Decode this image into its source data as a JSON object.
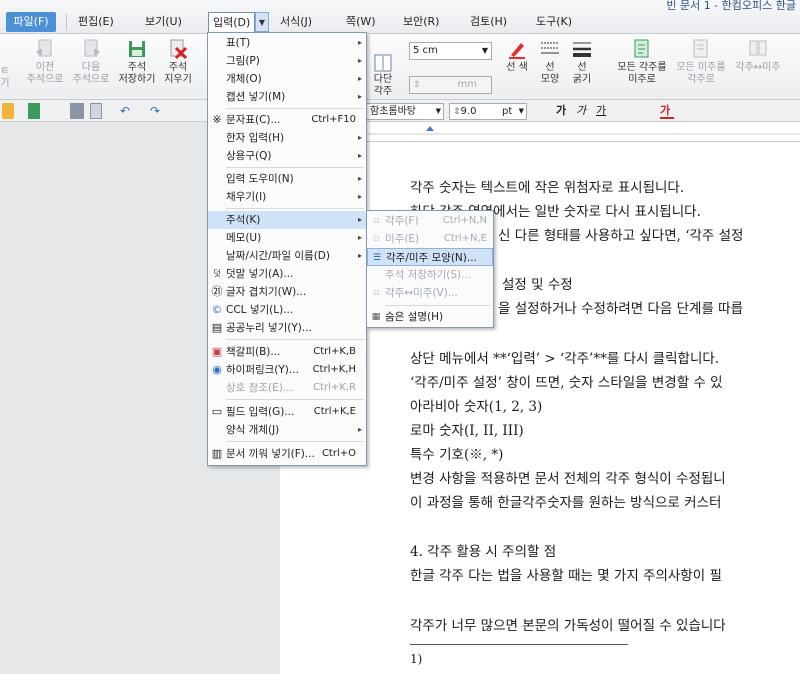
{
  "title": "빈 문서 1 - 한컴오피스 한글",
  "menubar": [
    "파일(F)",
    "편집(E)",
    "보기(U)",
    "입력(D)",
    "서식(J)",
    "쪽(W)",
    "보안(R)",
    "검토(H)",
    "도구(K)"
  ],
  "ribbon": {
    "prev_note": [
      "이전",
      "주석으로"
    ],
    "next_note": [
      "다음",
      "주석으로"
    ],
    "save_note": [
      "주석",
      "저장하기"
    ],
    "delete_note": [
      "주석",
      "지우기"
    ],
    "size_value": "5 cm",
    "size_unit": "mm",
    "multi_col": [
      "다단",
      "각주"
    ],
    "line_select": [
      "선 색",
      "선",
      "선"
    ],
    "line_shape": [
      "모양",
      "굵기"
    ],
    "to_endnote": [
      "모든 각주를",
      "미주로"
    ],
    "to_footnote": [
      "모든 미주를",
      "각주로"
    ],
    "swap": "각주↔미주"
  },
  "toolbar": {
    "font_name": "함초롬바탕",
    "font_size": "9.0",
    "font_unit": "pt",
    "styles": [
      "가",
      "가",
      "가"
    ]
  },
  "dropdown": {
    "items": [
      {
        "label": "표(T)",
        "arrow": true
      },
      {
        "label": "그림(P)",
        "arrow": true
      },
      {
        "label": "개체(O)",
        "arrow": true
      },
      {
        "label": "캡션 넣기(M)",
        "arrow": true
      },
      {
        "label": "문자표(C)...",
        "shortcut": "Ctrl+F10",
        "icon": "※"
      },
      {
        "label": "한자 입력(H)",
        "arrow": true
      },
      {
        "label": "상용구(Q)",
        "arrow": true
      },
      {
        "label": "입력 도우미(N)",
        "arrow": true
      },
      {
        "label": "채우기(I)",
        "arrow": true
      },
      {
        "label": "주석(K)",
        "arrow": true
      },
      {
        "label": "메모(U)",
        "arrow": true
      },
      {
        "label": "날짜/시간/파일 이름(D)",
        "arrow": true
      },
      {
        "label": "덧말 넣기(A)...",
        "icon": "덧"
      },
      {
        "label": "글자 겹치기(W)...",
        "icon": "㉑"
      },
      {
        "label": "CCL 넣기(L)...",
        "icon": "©"
      },
      {
        "label": "공공누리 넣기(Y)...",
        "icon": "▤"
      },
      {
        "label": "책갈피(B)...",
        "shortcut": "Ctrl+K,B",
        "icon": "▣"
      },
      {
        "label": "하이퍼링크(Y)...",
        "shortcut": "Ctrl+K,H",
        "icon": "◉"
      },
      {
        "label": "상호 참조(E)...",
        "shortcut": "Ctrl+K,R"
      },
      {
        "label": "필드 입력(G)...",
        "shortcut": "Ctrl+K,E",
        "icon": "▭"
      },
      {
        "label": "양식 개체(J)",
        "arrow": true
      },
      {
        "label": "문서 끼워 넣기(F)...",
        "shortcut": "Ctrl+O",
        "icon": "▥"
      }
    ]
  },
  "submenu": {
    "items": [
      {
        "label": "각주(F)",
        "shortcut": "Ctrl+N,N"
      },
      {
        "label": "미주(E)",
        "shortcut": "Ctrl+N,E"
      },
      {
        "label": "각주/미주 모양(N)..."
      },
      {
        "label": "주석 저장하기(S)..."
      },
      {
        "label": "각주↔미주(V)..."
      },
      {
        "label": "숨은 설명(H)"
      }
    ]
  },
  "document": {
    "lines": [
      "각주 숫자는 텍스트에 작은 위첨자로 표시됩니다.",
      "하단 각주 영역에서는 일반 숫자로 다시 표시됩니다.",
      "신 다른 형태를 사용하고 싶다면, ‘각주 설정",
      "설정 및 수정",
      "을 설정하거나 수정하려면 다음 단계를 따릅",
      "상단 메뉴에서 **‘입력’ > ‘각주’**를 다시 클릭합니다.",
      "‘각주/미주 설정’ 창이 뜨면, 숫자 스타일을 변경할 수 있",
      "아라비아 숫자(1, 2, 3)",
      "로마 숫자(I, II, III)",
      "특수 기호(※, *)",
      "변경 사항을 적용하면 문서 전체의 각주 형식이 수정됩니",
      "이 과정을 통해 한글각주숫자를 원하는 방식으로 커스터",
      "4. 각주 활용 시 주의할 점",
      "한글 각주 다는 법을 사용할 때는 몇 가지 주의사항이 필",
      "각주가 너무 많으면 본문의 가독성이 떨어질 수 있습니다",
      "1)"
    ]
  }
}
